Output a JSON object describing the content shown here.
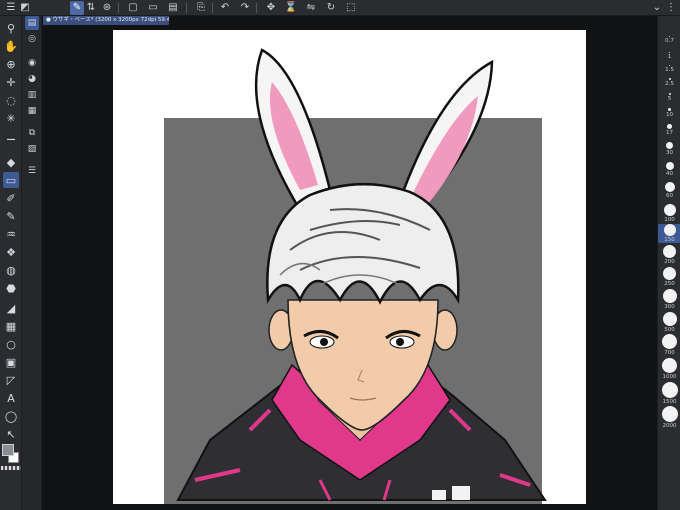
{
  "document_tab": {
    "label": "● ウサギ・ベース* (3200 x 3200px 72dpi 59.4%)"
  },
  "topbar": {
    "icons": [
      "menu-icon",
      "canvas-icon",
      "arrows-icon",
      "layer-icon",
      "new-icon",
      "open-icon",
      "save-icon",
      "export-icon",
      "undo-icon",
      "redo-icon",
      "transform-icon",
      "clip-icon",
      "flip-icon",
      "rotate-icon",
      "crop-icon",
      "more-icon"
    ]
  },
  "brush_sizes": [
    "0.7",
    "1",
    "1.5",
    "2.5",
    "5",
    "10",
    "17",
    "30",
    "40",
    "60",
    "100",
    "150",
    "200",
    "250",
    "300",
    "500",
    "700",
    "1000",
    "1500",
    "2000"
  ],
  "brush_sizes_selected": "150",
  "colors": {
    "accent": "#3d5a95",
    "panel": "#2b2c30",
    "canvas_bg": "#111214",
    "paper": "#ffffff",
    "backdrop_gray": "#6f6f6f",
    "hoodie_pink": "#e0398b",
    "hoodie_dark": "#2e2e33",
    "skin": "#f2ccaa"
  }
}
